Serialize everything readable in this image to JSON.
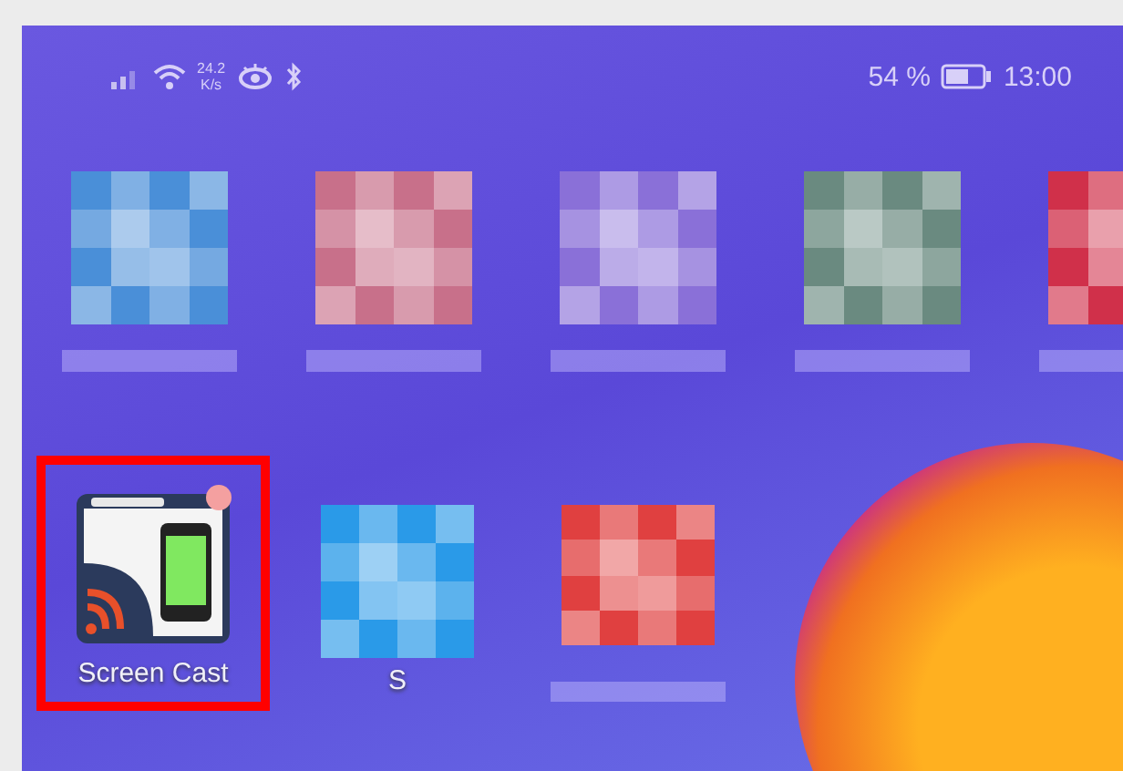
{
  "status_bar": {
    "network_speed": "24.2",
    "speed_unit": "K/s",
    "battery": "54 %",
    "time": "13:00"
  },
  "pixelated_row": [
    {
      "color": "#4a8fd8"
    },
    {
      "color": "#c8708a"
    },
    {
      "color": "#8a70d8"
    },
    {
      "color": "#6a8a80"
    },
    {
      "color": "#d0304a"
    }
  ],
  "apps": [
    {
      "kind": "screen-cast",
      "label": "Screen Cast",
      "highlighted": true
    },
    {
      "kind": "pixelated",
      "label": "S",
      "highlighted": false,
      "color": "#2a9ae8"
    },
    {
      "kind": "pixelated",
      "highlighted": false,
      "color": "#e04040"
    }
  ]
}
